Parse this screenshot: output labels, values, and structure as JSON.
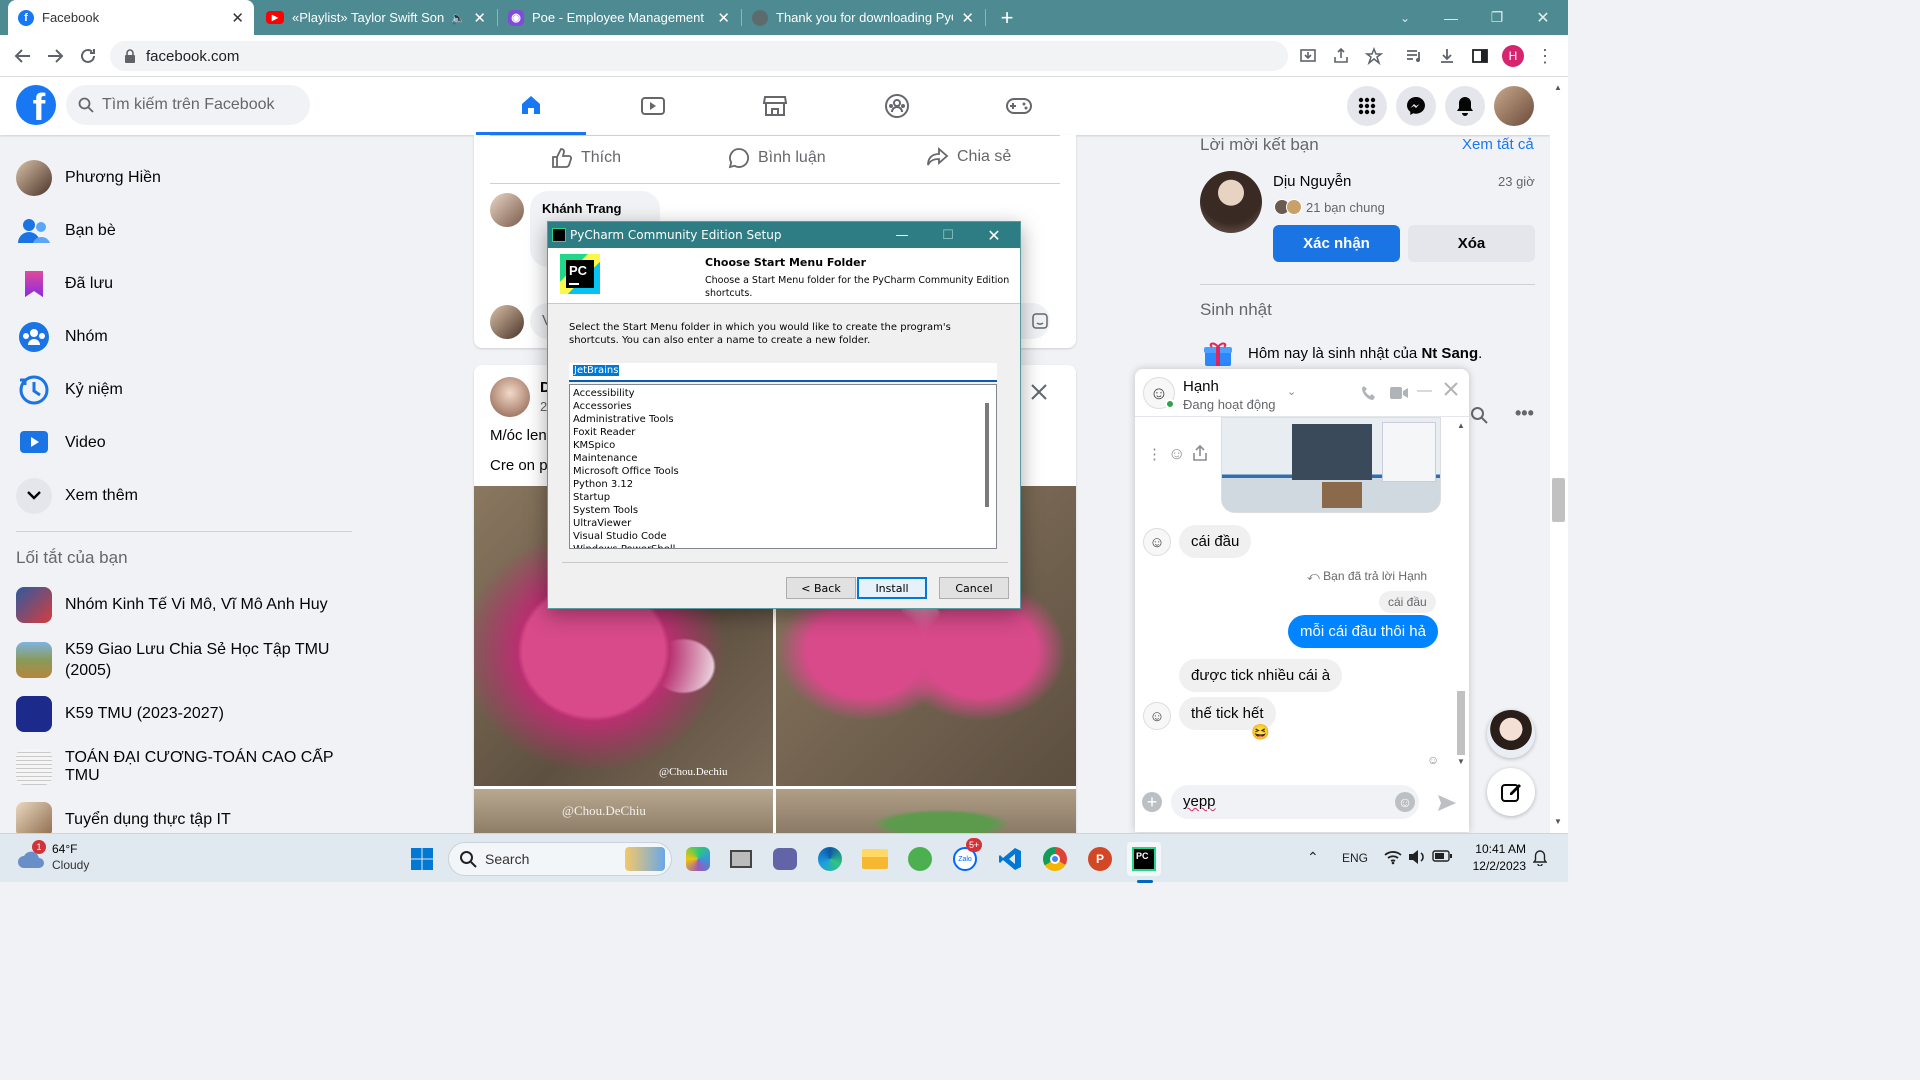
{
  "browser": {
    "tabs": [
      {
        "title": "Facebook",
        "active": true,
        "color": "#1877f2"
      },
      {
        "title": "«Playlist» Taylor Swift Songs",
        "color": "#ff0000"
      },
      {
        "title": "Poe - Employee Management",
        "color": "#7f4cd9"
      },
      {
        "title": "Thank you for downloading PyC",
        "color": "#6a6a6a"
      }
    ],
    "url": "facebook.com",
    "profile_initial": "H"
  },
  "facebook": {
    "search_placeholder": "Tìm kiếm trên Facebook",
    "sidebar": {
      "items": [
        {
          "label": "Phương Hiền",
          "icon": "avatar"
        },
        {
          "label": "Bạn bè",
          "icon": "friends-icon"
        },
        {
          "label": "Đã lưu",
          "icon": "saved-icon"
        },
        {
          "label": "Nhóm",
          "icon": "groups-icon"
        },
        {
          "label": "Kỷ niệm",
          "icon": "memories-icon"
        },
        {
          "label": "Video",
          "icon": "video-icon"
        },
        {
          "label": "Xem thêm",
          "icon": "chevron-down-icon"
        }
      ],
      "shortcuts_title": "Lối tắt của bạn",
      "shortcuts": [
        {
          "label": "Nhóm Kinh Tế Vi Mô, Vĩ Mô Anh Huy"
        },
        {
          "label": "K59 Giao Lưu Chia Sẻ Học Tập TMU",
          "label2": "(2005)"
        },
        {
          "label": "K59 TMU (2023-2027)"
        },
        {
          "label": "TOÁN ĐẠI CƯƠNG-TOÁN CAO CẤP TMU"
        },
        {
          "label": "Tuyển dụng thực tập IT"
        }
      ]
    },
    "post_actions": {
      "like": "Thích",
      "comment": "Bình luận",
      "share": "Chia sẻ"
    },
    "comment": {
      "author": "Khánh Trang",
      "placeholder_initial": "V"
    },
    "post2": {
      "author_initial": "D",
      "time_initial": "2",
      "text1": "M/óc len",
      "text2": "Cre on p",
      "watermark": "@Chou.Dechiu",
      "watermark2": "@Chou.DeChiu"
    },
    "friend_requests": {
      "title": "Lời mời kết bạn",
      "see_all": "Xem tất cả",
      "name": "Dịu Nguyễn",
      "time": "23 giờ",
      "mutual": "21 bạn chung",
      "confirm": "Xác nhận",
      "delete": "Xóa"
    },
    "birthdays": {
      "title": "Sinh nhật",
      "text": "Hôm nay là sinh nhật của ",
      "name": "Nt Sang",
      "suffix": "."
    },
    "chat": {
      "name": "Hạnh",
      "status": "Đang hoạt động",
      "messages": [
        {
          "from": "them",
          "text": "cái đầu"
        },
        {
          "from": "meta",
          "text": "Bạn đã trả lời Hạnh"
        },
        {
          "from": "quote",
          "text": "cái đầu"
        },
        {
          "from": "me",
          "text": "mỗi cái đầu thôi hả"
        },
        {
          "from": "them",
          "text": "được tick nhiều cái à"
        },
        {
          "from": "them",
          "text": "thế tick hết"
        }
      ],
      "input_value": "yepp"
    }
  },
  "installer": {
    "window_title": "PyCharm Community Edition Setup",
    "heading": "Choose Start Menu Folder",
    "subheading": "Choose a Start Menu folder for the PyCharm Community Edition shortcuts.",
    "instructions": "Select the Start Menu folder in which you would like to create the program's shortcuts. You can also enter a name to create a new folder.",
    "folder_value": "JetBrains",
    "folders": [
      "Accessibility",
      "Accessories",
      "Administrative Tools",
      "Foxit Reader",
      "KMSpico",
      "Maintenance",
      "Microsoft Office Tools",
      "Python 3.12",
      "Startup",
      "System Tools",
      "UltraViewer",
      "Visual Studio Code",
      "Windows PowerShell"
    ],
    "buttons": {
      "back": "< Back",
      "install": "Install",
      "cancel": "Cancel"
    }
  },
  "taskbar": {
    "weather_temp": "64°F",
    "weather_desc": "Cloudy",
    "weather_badge": "1",
    "search": "Search",
    "lang": "ENG",
    "time": "10:41 AM",
    "date": "12/2/2023",
    "zalo_badge": "5+"
  }
}
